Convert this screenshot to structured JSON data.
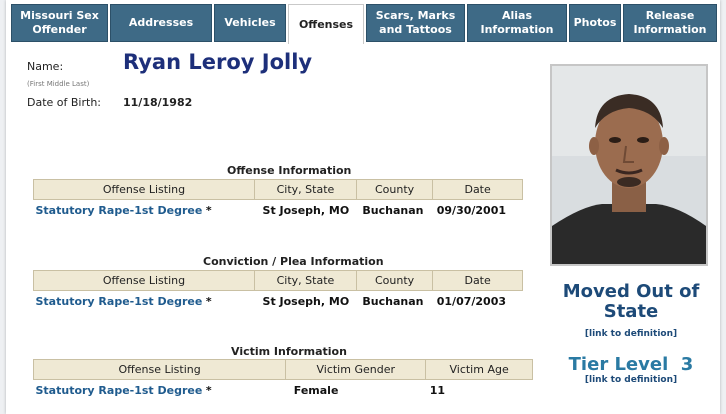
{
  "tabs": [
    {
      "label": "Missouri Sex Offender",
      "active": false
    },
    {
      "label": "Addresses",
      "active": false
    },
    {
      "label": "Vehicles",
      "active": false
    },
    {
      "label": "Offenses",
      "active": true
    },
    {
      "label": "Scars, Marks and Tattoos",
      "active": false
    },
    {
      "label": "Alias Information",
      "active": false
    },
    {
      "label": "Photos",
      "active": false
    },
    {
      "label": "Release Information",
      "active": false
    }
  ],
  "person": {
    "name_label": "Name:",
    "name": "Ryan Leroy Jolly",
    "name_hint": "(First Middle Last)",
    "dob_label": "Date of Birth:",
    "dob": "11/18/1982"
  },
  "offense_info": {
    "title": "Offense Information",
    "headers": [
      "Offense Listing",
      "City, State",
      "County",
      "Date"
    ],
    "rows": [
      {
        "offense": "Statutory Rape-1st Degree",
        "star": "*",
        "city": "St Joseph, MO",
        "county": "Buchanan",
        "date": "09/30/2001"
      }
    ]
  },
  "conviction_info": {
    "title": "Conviction / Plea Information",
    "headers": [
      "Offense Listing",
      "City, State",
      "County",
      "Date"
    ],
    "rows": [
      {
        "offense": "Statutory Rape-1st Degree",
        "star": "*",
        "city": "St Joseph, MO",
        "county": "Buchanan",
        "date": "01/07/2003"
      }
    ]
  },
  "victim_info": {
    "title": "Victim Information",
    "headers": [
      "Offense Listing",
      "Victim Gender",
      "Victim Age"
    ],
    "rows": [
      {
        "offense": "Statutory Rape-1st Degree",
        "star": "*",
        "gender": "Female",
        "age": "11"
      }
    ]
  },
  "status": {
    "line1": "Moved Out of",
    "line2": "State",
    "definition_link": "[link to definition]"
  },
  "tier": {
    "label": "Tier Level",
    "level": "3",
    "definition_link": "[link to definition]"
  },
  "colors": {
    "tab_bg": "#3e6a86",
    "header_bg": "#efe9d4",
    "link": "#1f5b8e",
    "name": "#1d2f7a",
    "tier": "#2a7aa3"
  }
}
